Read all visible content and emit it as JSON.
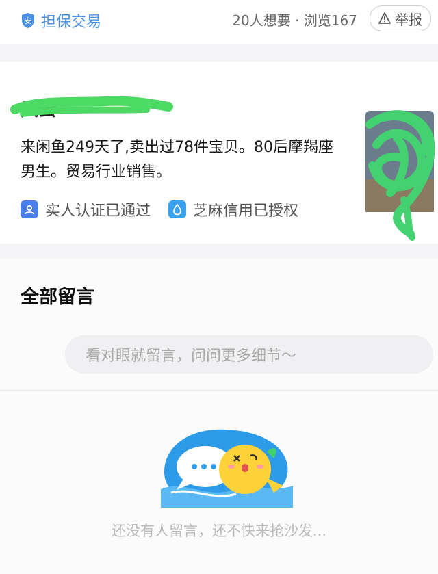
{
  "topbar": {
    "escrow_label": "担保交易",
    "stats": "20人想要 · 浏览167",
    "report_label": "举报"
  },
  "seller": {
    "name": "风云",
    "bio": "来闲鱼249天了,卖出过78件宝贝。80后摩羯座男生。贸易行业销售。",
    "badges": [
      {
        "label": "实人认证已通过",
        "icon": "person-verify-icon"
      },
      {
        "label": "芝麻信用已授权",
        "icon": "sesame-credit-icon"
      }
    ]
  },
  "comments": {
    "title": "全部留言",
    "input_placeholder": "看对眼就留言，问问更多细节～",
    "empty_text": "还没有人留言，还不快来抢沙发..."
  },
  "colors": {
    "accent_blue": "#4a90e2",
    "scribble_green": "#4cd964"
  }
}
